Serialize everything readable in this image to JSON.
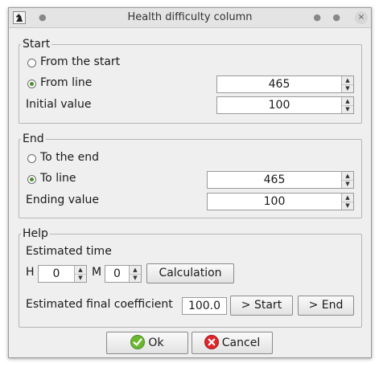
{
  "window": {
    "title": "Health difficulty column",
    "close_glyph": "×"
  },
  "start": {
    "legend": "Start",
    "from_start_label": "From the start",
    "from_line_label": "From line",
    "from_line_value": "465",
    "initial_label": "Initial value",
    "initial_value": "100",
    "selected": "from_line"
  },
  "end": {
    "legend": "End",
    "to_end_label": "To the end",
    "to_line_label": "To line",
    "to_line_value": "465",
    "ending_label": "Ending value",
    "ending_value": "100",
    "selected": "to_line"
  },
  "help": {
    "legend": "Help",
    "estimated_time_label": "Estimated time",
    "h_label": "H",
    "h_value": "0",
    "m_label": "M",
    "m_value": "0",
    "calculation_label": "Calculation",
    "coef_label": "Estimated final coefficient",
    "coef_value": "100.0",
    "to_start_label": "> Start",
    "to_end_label": "> End"
  },
  "buttons": {
    "ok_label": "Ok",
    "cancel_label": "Cancel"
  },
  "icons": {
    "app": "chess-knight-icon",
    "ok": "check-circle-icon",
    "cancel": "x-circle-icon",
    "spinner_up": "arrow-up-icon",
    "spinner_down": "arrow-down-icon"
  },
  "colors": {
    "ok_green": "#6ab82e",
    "cancel_red": "#e0262b",
    "radio_dot": "#4d8c2f"
  }
}
